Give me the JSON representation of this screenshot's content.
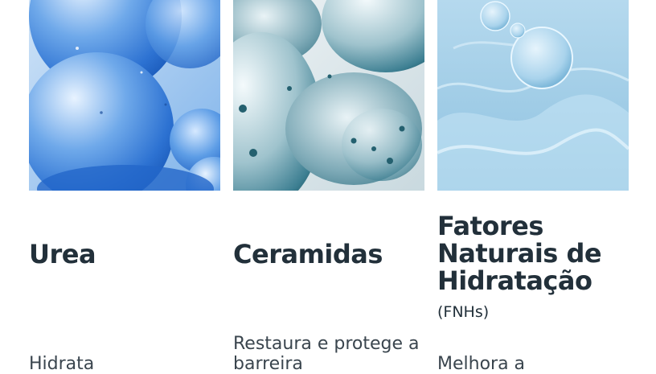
{
  "cards": [
    {
      "title": "Urea",
      "description": "Hidrata",
      "image": "blue-spheres-image"
    },
    {
      "title": "Ceramidas",
      "description": "Restaura e protege a barreira",
      "image": "teal-spheres-image"
    },
    {
      "title_line1": "Fatores",
      "title_line2": "Naturais de",
      "title_line3": "Hidratação",
      "title_suffix": "(FNHs)",
      "description": "Melhora a",
      "image": "water-ripple-image"
    }
  ],
  "colors": {
    "title": "#22303a",
    "text": "#3a454e",
    "blue": "#2f7fd6",
    "teal": "#3d7f92",
    "aqua": "#9ccbe6"
  }
}
